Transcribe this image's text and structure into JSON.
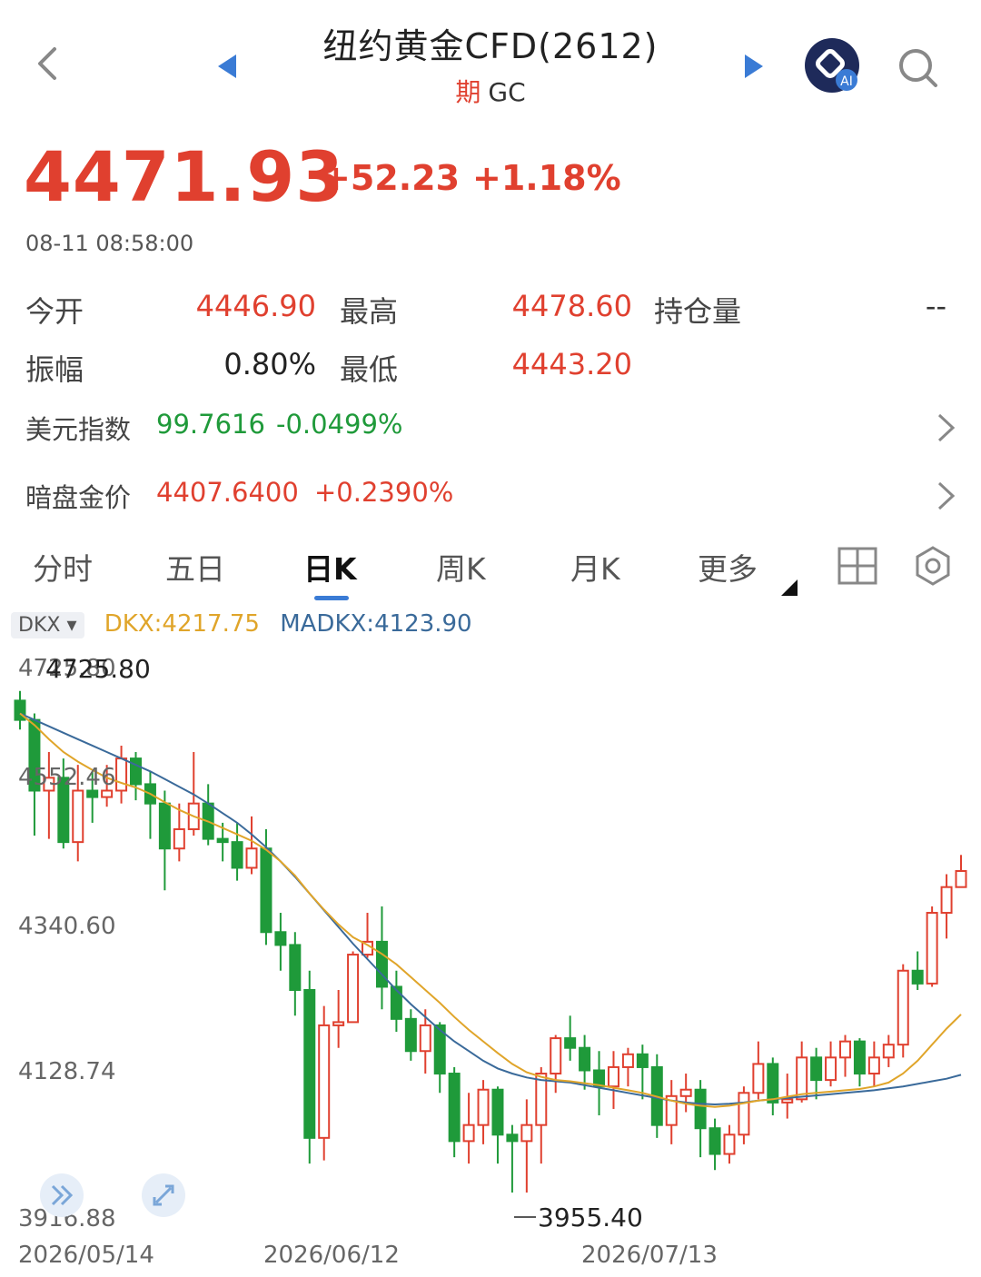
{
  "header": {
    "title": "纽约黄金CFD(2612)",
    "subtitle_tag": "期",
    "subtitle_code": "GC",
    "ai_label": "AI"
  },
  "quote": {
    "price": "4471.93",
    "change": "+52.23",
    "change_pct": "+1.18%",
    "time": "08-11 08:58:00"
  },
  "stats": {
    "open_label": "今开",
    "open": "4446.90",
    "high_label": "最高",
    "high": "4478.60",
    "oi_label": "持仓量",
    "oi": "--",
    "amp_label": "振幅",
    "amp": "0.80%",
    "low_label": "最低",
    "low": "4443.20"
  },
  "related": {
    "usd_label": "美元指数",
    "usd_value": "99.7616",
    "usd_change": "-0.0499%",
    "dark_label": "暗盘金价",
    "dark_value": "4407.6400",
    "dark_change": "+0.2390%"
  },
  "tabs": [
    "分时",
    "五日",
    "日K",
    "周K",
    "月K",
    "更多"
  ],
  "active_tab": "日K",
  "indicator": {
    "name": "DKX",
    "dkx_text": "DKX:4217.75",
    "madkx_text": "MADKX:4123.90"
  },
  "colors": {
    "up": "#e0402f",
    "down": "#1f9a3a",
    "dkx": "#e0a52a",
    "madkx": "#3a6a9a",
    "accent": "#3a7bd5"
  },
  "chart_data": {
    "type": "candlestick",
    "title": "",
    "y_ticks": [
      "4725.80",
      "4552.46",
      "4340.60",
      "4128.74",
      "3916.88"
    ],
    "x_ticks": [
      "2026/05/14",
      "2026/06/12",
      "2026/07/13"
    ],
    "ylim": [
      3916.88,
      4764.32
    ],
    "max_label": "4725.80",
    "min_label": "3955.40",
    "candles": [
      [
        4720,
        4690,
        4735,
        4675
      ],
      [
        4690,
        4580,
        4700,
        4510
      ],
      [
        4580,
        4600,
        4640,
        4505
      ],
      [
        4600,
        4500,
        4630,
        4490
      ],
      [
        4500,
        4580,
        4620,
        4470
      ],
      [
        4580,
        4570,
        4610,
        4530
      ],
      [
        4570,
        4580,
        4620,
        4555
      ],
      [
        4580,
        4630,
        4650,
        4560
      ],
      [
        4630,
        4590,
        4640,
        4565
      ],
      [
        4590,
        4560,
        4610,
        4505
      ],
      [
        4560,
        4490,
        4580,
        4425
      ],
      [
        4490,
        4520,
        4560,
        4470
      ],
      [
        4520,
        4560,
        4640,
        4510
      ],
      [
        4560,
        4505,
        4590,
        4495
      ],
      [
        4505,
        4500,
        4530,
        4470
      ],
      [
        4500,
        4460,
        4530,
        4440
      ],
      [
        4460,
        4490,
        4540,
        4450
      ],
      [
        4490,
        4360,
        4520,
        4340
      ],
      [
        4360,
        4340,
        4390,
        4300
      ],
      [
        4340,
        4270,
        4360,
        4230
      ],
      [
        4270,
        4040,
        4300,
        4000
      ],
      [
        4040,
        4215,
        4245,
        4005
      ],
      [
        4215,
        4220,
        4270,
        4180
      ],
      [
        4220,
        4325,
        4330,
        4240
      ],
      [
        4325,
        4345,
        4390,
        4320
      ],
      [
        4345,
        4275,
        4400,
        4240
      ],
      [
        4275,
        4225,
        4300,
        4205
      ],
      [
        4225,
        4175,
        4240,
        4160
      ],
      [
        4175,
        4215,
        4240,
        4140
      ],
      [
        4215,
        4140,
        4220,
        4110
      ],
      [
        4140,
        4035,
        4150,
        4010
      ],
      [
        4035,
        4060,
        4110,
        4000
      ],
      [
        4060,
        4115,
        4130,
        4030
      ],
      [
        4115,
        4045,
        4120,
        4000
      ],
      [
        4045,
        4035,
        4060,
        3955
      ],
      [
        4035,
        4060,
        4100,
        3955
      ],
      [
        4060,
        4140,
        4150,
        4000
      ],
      [
        4140,
        4195,
        4200,
        4110
      ],
      [
        4195,
        4180,
        4230,
        4160
      ],
      [
        4180,
        4145,
        4200,
        4115
      ],
      [
        4145,
        4120,
        4175,
        4075
      ],
      [
        4120,
        4150,
        4175,
        4085
      ],
      [
        4150,
        4170,
        4180,
        4120
      ],
      [
        4170,
        4150,
        4185,
        4100
      ],
      [
        4150,
        4060,
        4170,
        4040
      ],
      [
        4060,
        4105,
        4130,
        4030
      ],
      [
        4105,
        4115,
        4140,
        4080
      ],
      [
        4115,
        4055,
        4130,
        4010
      ],
      [
        4055,
        4015,
        4070,
        3990
      ],
      [
        4015,
        4045,
        4060,
        4000
      ],
      [
        4045,
        4110,
        4120,
        4030
      ],
      [
        4110,
        4155,
        4190,
        4100
      ],
      [
        4155,
        4095,
        4165,
        4075
      ],
      [
        4095,
        4100,
        4140,
        4070
      ],
      [
        4100,
        4165,
        4190,
        4095
      ],
      [
        4165,
        4130,
        4180,
        4100
      ],
      [
        4130,
        4165,
        4190,
        4120
      ],
      [
        4165,
        4190,
        4200,
        4135
      ],
      [
        4190,
        4140,
        4195,
        4120
      ],
      [
        4140,
        4165,
        4190,
        4120
      ],
      [
        4165,
        4185,
        4200,
        4150
      ],
      [
        4185,
        4300,
        4310,
        4165
      ],
      [
        4300,
        4280,
        4330,
        4270
      ],
      [
        4280,
        4390,
        4400,
        4275
      ],
      [
        4390,
        4430,
        4450,
        4350
      ],
      [
        4430,
        4455,
        4480,
        4435
      ]
    ],
    "dkx": [
      4700,
      4682,
      4660,
      4640,
      4625,
      4612,
      4600,
      4592,
      4585,
      4575,
      4562,
      4550,
      4540,
      4532,
      4522,
      4512,
      4502,
      4488,
      4470,
      4448,
      4420,
      4395,
      4372,
      4352,
      4340,
      4326,
      4310,
      4290,
      4270,
      4250,
      4228,
      4208,
      4190,
      4172,
      4155,
      4142,
      4135,
      4130,
      4128,
      4125,
      4122,
      4118,
      4114,
      4110,
      4104,
      4098,
      4093,
      4090,
      4088,
      4090,
      4094,
      4098,
      4100,
      4104,
      4108,
      4110,
      4112,
      4114,
      4116,
      4120,
      4126,
      4140,
      4160,
      4185,
      4210,
      4232
    ],
    "madkx": [
      4700,
      4690,
      4680,
      4670,
      4660,
      4650,
      4640,
      4630,
      4620,
      4610,
      4598,
      4586,
      4574,
      4560,
      4545,
      4530,
      4512,
      4492,
      4470,
      4446,
      4420,
      4394,
      4368,
      4342,
      4318,
      4294,
      4270,
      4248,
      4228,
      4208,
      4190,
      4175,
      4160,
      4148,
      4140,
      4134,
      4130,
      4128,
      4126,
      4122,
      4118,
      4114,
      4110,
      4106,
      4102,
      4098,
      4095,
      4093,
      4092,
      4093,
      4095,
      4098,
      4100,
      4102,
      4104,
      4106,
      4108,
      4110,
      4112,
      4114,
      4117,
      4120,
      4124,
      4128,
      4132,
      4138
    ]
  }
}
